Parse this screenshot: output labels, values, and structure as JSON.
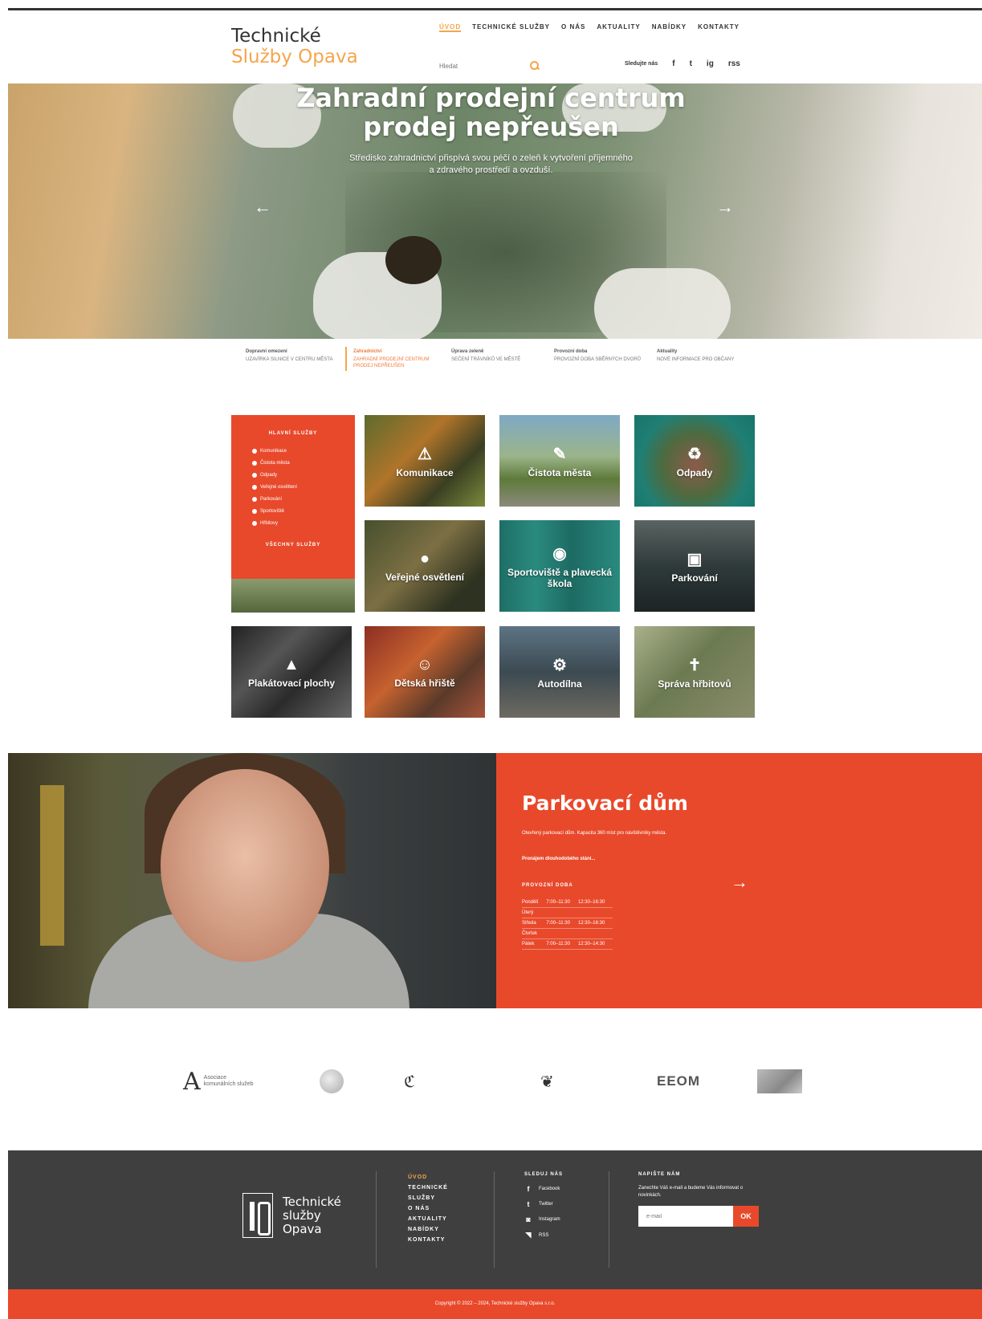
{
  "header": {
    "logo_line1": "Technické",
    "logo_line2": "Služby Opava",
    "nav": [
      "ÚVOD",
      "TECHNICKÉ SLUŽBY",
      "O NÁS",
      "AKTUALITY",
      "NABÍDKY",
      "KONTAKTY"
    ],
    "search_placeholder": "Hledat",
    "follow_label": "Sledujte nás",
    "social": [
      "f",
      "t",
      "ig",
      "rss"
    ]
  },
  "hero": {
    "title_line1": "Zahradní prodejní centrum",
    "title_line2": "prodej nepřeušen",
    "subtitle_line1": "Středisko zahradnictví přispívá svou péčí o zeleň k vytvoření příjemného",
    "subtitle_line2": "a zdravého prostředí a ovzduší.",
    "prev_arrow": "←",
    "next_arrow": "→"
  },
  "news": [
    {
      "title": "Dopravní omezení",
      "text": "UZAVÍRKA SILNICE V CENTRU MĚSTA"
    },
    {
      "title": "Zahradnictví",
      "text": "ZAHRADNÍ PRODEJNÍ CENTRUM PRODEJ NEPŘEUŠEN"
    },
    {
      "title": "Úprava zeleně",
      "text": "SEČENÍ TRÁVNÍKŮ VE MĚSTĚ"
    },
    {
      "title": "Provozní doba",
      "text": "PROVOZNÍ DOBA SBĚRNÝCH DVORŮ"
    },
    {
      "title": "Aktuality",
      "text": "NOVÉ INFORMACE PRO OBČANY"
    }
  ],
  "services_panel": {
    "heading": "HLAVNÍ SLUŽBY",
    "items": [
      "Komunikace",
      "Čistota města",
      "Odpady",
      "Veřejné osvětlení",
      "Parkování",
      "Sportoviště",
      "Hřbitovy"
    ],
    "more": "VŠECHNY SLUŽBY"
  },
  "tiles": [
    {
      "label": "Komunikace",
      "icon": "⚠"
    },
    {
      "label": "Čistota města",
      "icon": "✎"
    },
    {
      "label": "Odpady",
      "icon": "♻"
    },
    {
      "label": "Veřejné osvětlení",
      "icon": "●"
    },
    {
      "label": "Sportoviště a plavecká škola",
      "icon": "◉"
    },
    {
      "label": "Parkování",
      "icon": "▣"
    },
    {
      "label": "Plakátovací plochy",
      "icon": "▲"
    },
    {
      "label": "Dětská hřiště",
      "icon": "☺"
    },
    {
      "label": "Autodílna",
      "icon": "⚙"
    },
    {
      "label": "Správa hřbitovů",
      "icon": "✝"
    }
  ],
  "parking": {
    "title": "Parkovací dům",
    "text1": "Otevřený parkovací dům. Kapacita 360 míst pro návštěvníky města.",
    "text2": "Pronájem dlouhodobého stání...",
    "hours_heading": "PROVOZNÍ DOBA",
    "hours": [
      [
        "Pondělí",
        "7:00–11:30",
        "12:30–16:30"
      ],
      [
        "Úterý",
        "",
        ""
      ],
      [
        "Středa",
        "7:00–11:30",
        "12:30–16:30"
      ],
      [
        "Čtvrtek",
        "",
        ""
      ],
      [
        "Pátek",
        "7:00–11:30",
        "12:30–14:30"
      ]
    ],
    "arrow": "→"
  },
  "partners": {
    "eaa_initial": "A",
    "eaa_text": "Asociace komunálních služeb",
    "wave": "ℭ",
    "bird": "❦",
    "eeom": "EEOM"
  },
  "footer": {
    "logo_line1": "Technické",
    "logo_line2": "služby",
    "logo_line3": "Opava",
    "nav": [
      "ÚVOD",
      "TECHNICKÉ",
      "SLUŽBY",
      "O NÁS",
      "AKTUALITY",
      "NABÍDKY",
      "KONTAKTY"
    ],
    "social_heading": "SLEDUJ NÁS",
    "social": [
      {
        "icon": "f",
        "label": "Facebook"
      },
      {
        "icon": "t",
        "label": "Twitter"
      },
      {
        "icon": "◙",
        "label": "Instagram"
      },
      {
        "icon": "◥",
        "label": "RSS"
      }
    ],
    "mail_heading": "NAPIŠTE NÁM",
    "mail_desc": "Zanechte Váš e-mail a budeme Vás informovat o novinkách.",
    "mail_placeholder": "e-mail",
    "mail_button": "OK",
    "copyright": "Copyright © 2022 – 2024, Technické služby Opava s.r.o."
  }
}
